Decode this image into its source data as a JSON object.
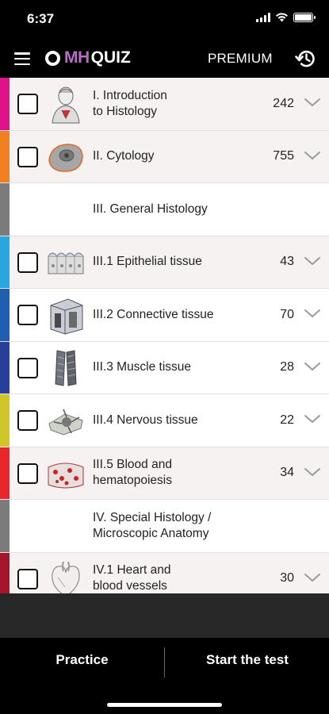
{
  "status_bar": {
    "time": "6:37"
  },
  "header": {
    "logo_mh": "MH",
    "logo_quiz": "QUIZ",
    "premium_label": "PREMIUM"
  },
  "topics": [
    {
      "label": "I. Introduction\nto Histology",
      "count": "242",
      "color": "#e0128a",
      "has_checkbox": true,
      "icon": "portrait-icon",
      "tint": true
    },
    {
      "label": "II. Cytology",
      "count": "755",
      "color": "#f08022",
      "has_checkbox": true,
      "icon": "cell-icon",
      "tint": true
    },
    {
      "label": "III. General Histology",
      "count": "",
      "color": "#7b7b7b",
      "has_checkbox": false,
      "icon": "",
      "tint": false
    },
    {
      "label": "III.1 Epithelial tissue",
      "count": "43",
      "color": "#2aa6df",
      "has_checkbox": true,
      "icon": "epithelium-icon",
      "tint": true
    },
    {
      "label": "III.2 Connective tissue",
      "count": "70",
      "color": "#1f5fb0",
      "has_checkbox": true,
      "icon": "connective-tissue-icon",
      "tint": false
    },
    {
      "label": "III.3 Muscle tissue",
      "count": "28",
      "color": "#283f99",
      "has_checkbox": true,
      "icon": "muscle-icon",
      "tint": false
    },
    {
      "label": "III.4 Nervous tissue",
      "count": "22",
      "color": "#cfc62a",
      "has_checkbox": true,
      "icon": "neuron-icon",
      "tint": false
    },
    {
      "label": "III.5 Blood and\nhematopoiesis",
      "count": "34",
      "color": "#e8262b",
      "has_checkbox": true,
      "icon": "blood-icon",
      "tint": true
    },
    {
      "label": "IV. Special Histology /\nMicroscopic Anatomy",
      "count": "",
      "color": "#7b7b7b",
      "has_checkbox": false,
      "icon": "",
      "tint": false
    },
    {
      "label": "IV.1 Heart and\nblood vessels",
      "count": "30",
      "color": "#a5162c",
      "has_checkbox": true,
      "icon": "heart-icon",
      "tint": true
    }
  ],
  "footer": {
    "practice_label": "Practice",
    "start_label": "Start the test"
  }
}
